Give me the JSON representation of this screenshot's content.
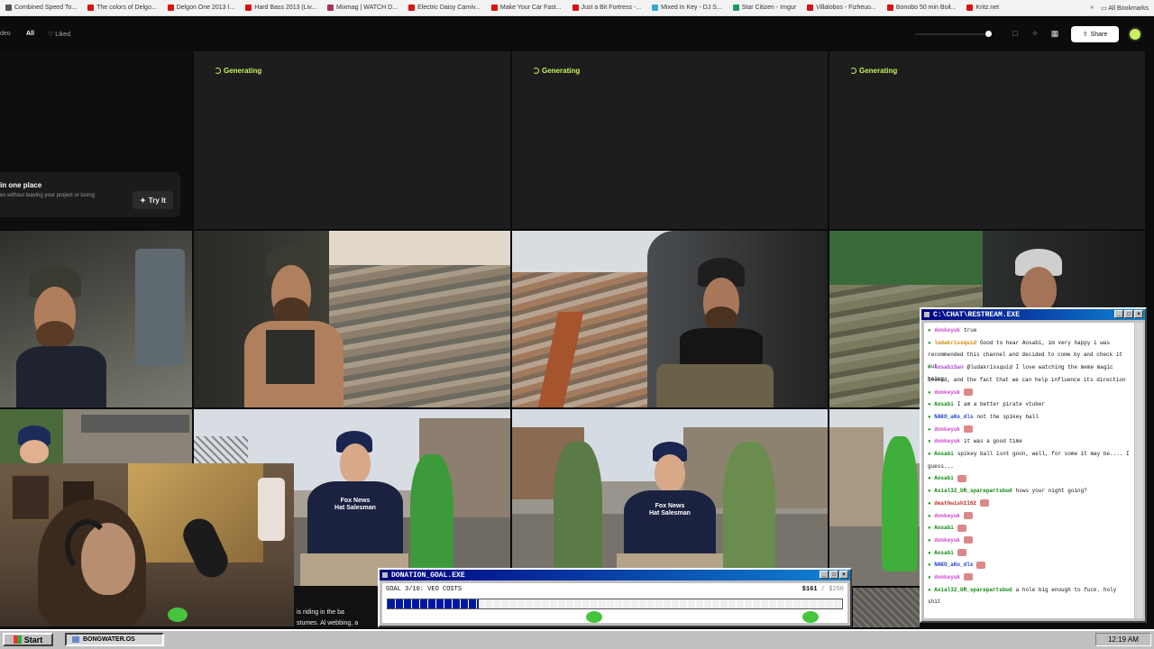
{
  "bookmarks": {
    "items": [
      {
        "label": "Combined Speed To...",
        "color": "#555555"
      },
      {
        "label": "The colors of Delgo...",
        "color": "#dd1111"
      },
      {
        "label": "Delgon One 2013 I...",
        "color": "#dd1111"
      },
      {
        "label": "Hard Bass 2013 (Liv...",
        "color": "#dd1111"
      },
      {
        "label": "Mixmag | WATCH D...",
        "color": "#aa3355"
      },
      {
        "label": "Electric Daisy Carniv...",
        "color": "#dd1111"
      },
      {
        "label": "Make Your Car Fast...",
        "color": "#dd1111"
      },
      {
        "label": "Just a Bit Fortress -...",
        "color": "#dd1111"
      },
      {
        "label": "Mixed In Key - DJ S...",
        "color": "#33aadd"
      },
      {
        "label": "Star Citizen - Imgur",
        "color": "#1c9e5a"
      },
      {
        "label": "Villalobos - Fizheuo...",
        "color": "#dd1111"
      },
      {
        "label": "Bonobo 50 min Boil...",
        "color": "#dd1111"
      },
      {
        "label": "Kritz.net",
        "color": "#dd1111"
      }
    ],
    "overflow": "»",
    "all_bookmarks": "All Bookmarks"
  },
  "header": {
    "video_tab": "deo",
    "all_tab": "All",
    "liked_tab": "Liked",
    "share_label": "Share"
  },
  "generating": {
    "label": "Generating"
  },
  "promo": {
    "title": "in one place",
    "subtitle": "es without leaving your project or losing",
    "try_label": "Try It"
  },
  "tiles": {
    "shirt_text_1": "Fox News\nHat Salesman",
    "shirt_text_2": "Fox News\nHat Salesman",
    "caption": "is riding in the ba",
    "caption2": "stumes. Al webbing, a"
  },
  "chat": {
    "title": "C:\\CHAT\\RESTREAM.EXE",
    "messages": [
      {
        "user": "donkeyuk",
        "text": "true",
        "color": "#cc44cc"
      },
      {
        "user": "ludakrissquid",
        "text": "Good to hear Aosabi, im very happy i was",
        "color": "#cc8800"
      },
      {
        "user": "",
        "text": "recommended this channel and decided to come by and check it out",
        "color": "#111111"
      },
      {
        "user": "AosabiSan",
        "text": "@ludakrissquid I love watching the meme magic being",
        "color": "#aa44cc"
      },
      {
        "user": "",
        "text": "cooked, and the fact that we can help influence its direction",
        "color": "#111111"
      },
      {
        "user": "donkeyuk",
        "text": "",
        "color": "#cc44cc"
      },
      {
        "user": "Aosabi",
        "text": "I am a better pirate vtuber",
        "color": "#118811"
      },
      {
        "user": "NAKO_aKo_dls",
        "text": "not the spikey ball",
        "color": "#2244cc"
      },
      {
        "user": "donkeyuk",
        "text": "",
        "color": "#cc44cc"
      },
      {
        "user": "donkeyuk",
        "text": "it was a good time",
        "color": "#cc44cc"
      },
      {
        "user": "Aosabi",
        "text": "spikey ball isnt goon, well, for some it may be.... I",
        "color": "#118811"
      },
      {
        "user": "",
        "text": "guess...",
        "color": "#111111"
      },
      {
        "user": "Aosabi",
        "text": "",
        "color": "#118811"
      },
      {
        "user": "Axial32_UR_sparepartsbud",
        "text": "hows your night going?",
        "color": "#118811"
      },
      {
        "user": "deathwish1162",
        "text": "",
        "color": "#cc2222"
      },
      {
        "user": "donkeyuk",
        "text": "",
        "color": "#cc44cc"
      },
      {
        "user": "Aosabi",
        "text": "",
        "color": "#118811"
      },
      {
        "user": "donkeyuk",
        "text": "",
        "color": "#cc44cc"
      },
      {
        "user": "Aosabi",
        "text": "",
        "color": "#118811"
      },
      {
        "user": "NAKO_aKo_dls",
        "text": "",
        "color": "#2244cc"
      },
      {
        "user": "donkeyuk",
        "text": "",
        "color": "#cc44cc"
      },
      {
        "user": "Axial32_UR_sparepartsbud",
        "text": "a hole big enough to fuck. holy shit",
        "color": "#118811"
      }
    ]
  },
  "donation": {
    "title": "DONATION_GOAL.EXE",
    "goal_label": "GOAL 3/10: VEO COSTS",
    "amount": "$161",
    "total": "/ $250",
    "progress": 0.2
  },
  "taskbar": {
    "start_label": "Start",
    "task_label": "BONGWATER.OS",
    "clock": "12:19 AM"
  },
  "colors": {
    "accent": "#c8f060",
    "win_blue": "#000080"
  }
}
